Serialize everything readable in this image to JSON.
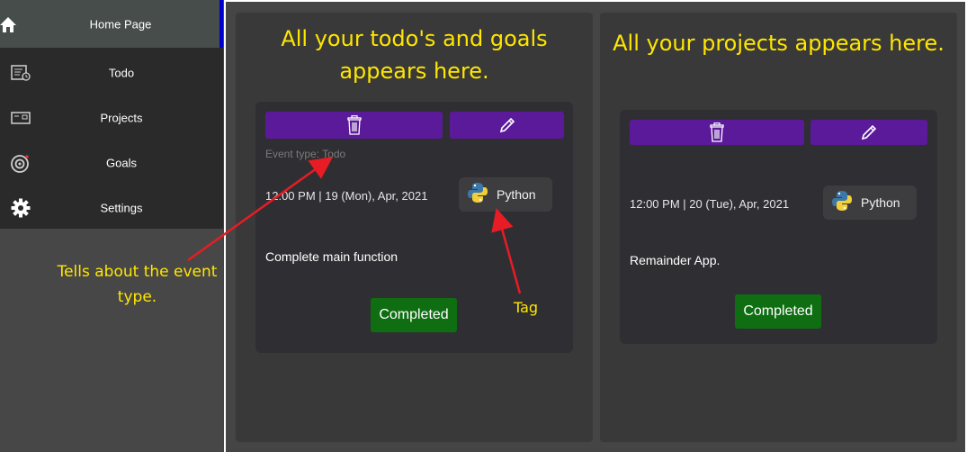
{
  "sidebar": {
    "items": [
      {
        "label": "Home Page",
        "icon": "home-icon"
      },
      {
        "label": "Todo",
        "icon": "todo-list-icon"
      },
      {
        "label": "Projects",
        "icon": "projects-icon"
      },
      {
        "label": "Goals",
        "icon": "target-icon"
      },
      {
        "label": "Settings",
        "icon": "gear-icon"
      }
    ],
    "accent": "#0000cc"
  },
  "annotations": {
    "event_type_note": "Tells about the event type.",
    "tag_note": "Tag"
  },
  "todo_panel": {
    "title": "All your todo's and goals appears here.",
    "card": {
      "event_type": "Event type: Todo",
      "datetime": "12:00 PM | 19 (Mon), Apr, 2021",
      "tag": "Python",
      "description": "Complete main function",
      "status": "Completed"
    }
  },
  "projects_panel": {
    "title": "All your projects appears here.",
    "card": {
      "datetime": "12:00 PM | 20 (Tue), Apr, 2021",
      "tag": "Python",
      "description": "Remainder App.",
      "status": "Completed"
    }
  },
  "colors": {
    "button": "#5b1a9a",
    "status": "#0f6e12",
    "highlight": "#ffe600"
  }
}
